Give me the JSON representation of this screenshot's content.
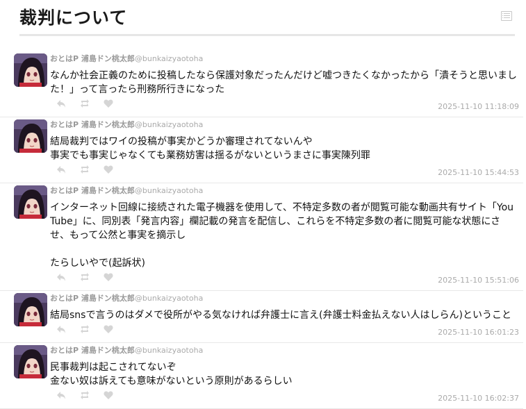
{
  "page": {
    "title": "裁判について"
  },
  "tweets": [
    {
      "name": "おとはP 浦島ドン桃太郎",
      "handle": "@bunkaizyaotoha",
      "text": "なんか社会正義のために投稿したなら保護対象だったんだけど嘘つきたくなかったから「潰そうと思いました！」って言ったら刑務所行きになった",
      "time": "2025-11-10 11:18:09"
    },
    {
      "name": "おとはP 浦島ドン桃太郎",
      "handle": "@bunkaizyaotoha",
      "text": "結局裁判ではワイの投稿が事実かどうか審理されてないんや\n事実でも事実じゃなくても業務妨害は揺るがないというまさに事実陳列罪",
      "time": "2025-11-10 15:44:53"
    },
    {
      "name": "おとはP 浦島ドン桃太郎",
      "handle": "@bunkaizyaotoha",
      "text": "インターネット回線に接続された電子機器を使用して、不特定多数の者が閲覧可能な動画共有サイト「YouTube」に、同別表「発言内容」欄記載の発言を配信し、これらを不特定多数の者に閲覧可能な状態にさせ、もって公然と事実を摘示し\n\nたらしいやで(起訴状)",
      "time": "2025-11-10 15:51:06"
    },
    {
      "name": "おとはP 浦島ドン桃太郎",
      "handle": "@bunkaizyaotoha",
      "text": "結局snsで言うのはダメで役所がやる気なければ弁護士に言え(弁護士料金払えない人はしらん)ということ",
      "time": "2025-11-10 16:01:23"
    },
    {
      "name": "おとはP 浦島ドン桃太郎",
      "handle": "@bunkaizyaotoha",
      "text": "民事裁判は起こされてないぞ\n金ない奴は訴えても意味がないという原則があるらしい",
      "time": "2025-11-10 16:02:37"
    }
  ]
}
